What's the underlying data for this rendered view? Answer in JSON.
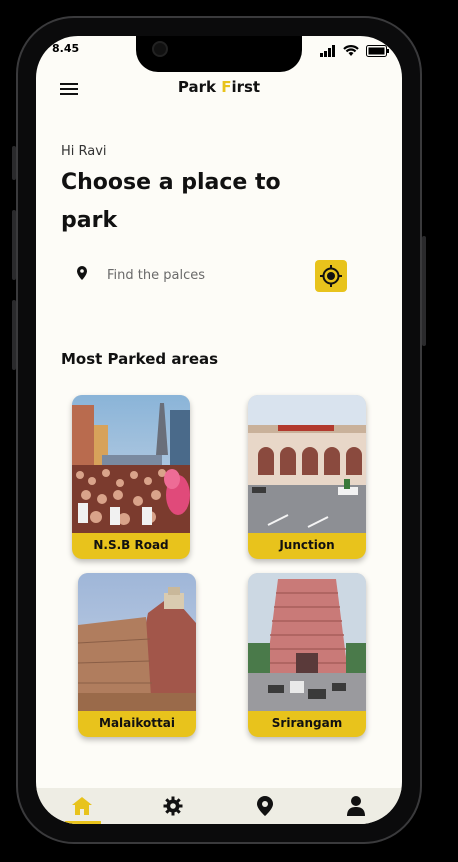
{
  "status": {
    "time": "8.45"
  },
  "app": {
    "title_part1": "Park ",
    "title_accent": "F",
    "title_part2": "irst"
  },
  "greeting": "Hi Ravi",
  "headline": "Choose a place to park",
  "search": {
    "placeholder": "Find the palces"
  },
  "section_title": "Most Parked areas",
  "areas": [
    {
      "label": "N.S.B Road"
    },
    {
      "label": "Junction"
    },
    {
      "label": "Malaikottai"
    },
    {
      "label": "Srirangam"
    }
  ],
  "tabs": [
    {
      "name": "home-icon",
      "active": true
    },
    {
      "name": "gear-icon",
      "active": false
    },
    {
      "name": "map-pin-icon",
      "active": false
    },
    {
      "name": "user-icon",
      "active": false
    }
  ],
  "colors": {
    "accent": "#e8c31c",
    "background": "#fdfcf7",
    "tabbar": "#eeede4"
  }
}
